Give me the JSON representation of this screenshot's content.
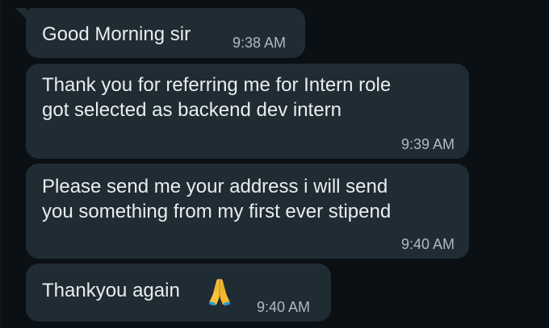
{
  "messages": [
    {
      "text": "Good Morning sir",
      "time": "9:38 AM"
    },
    {
      "text": "Thank you for referring me for Intern role\ngot selected as backend dev intern",
      "time": "9:39 AM"
    },
    {
      "text": "Please send me your address i will send\nyou something from my first ever stipend",
      "time": "9:40 AM"
    },
    {
      "text": "Thankyou again",
      "emoji": "folded-hands-icon",
      "time": "9:40 AM"
    }
  ],
  "colors": {
    "background": "#0b1014",
    "bubble": "#202c33",
    "text": "#e9edef",
    "timestamp": "#aebac1"
  }
}
